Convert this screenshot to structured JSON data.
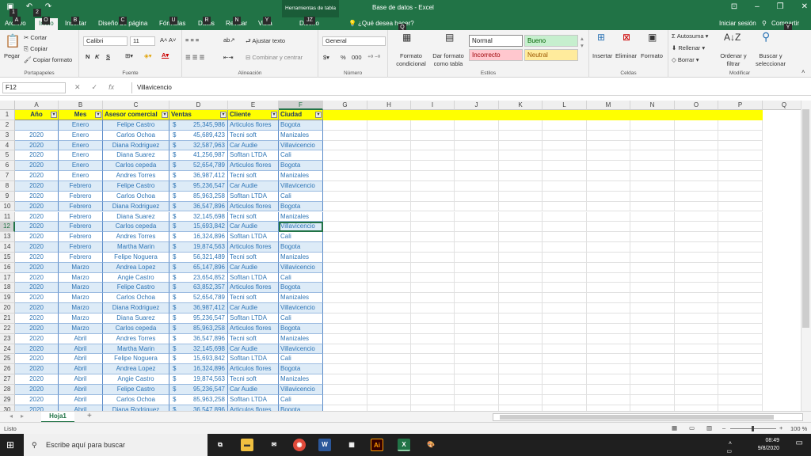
{
  "window": {
    "doc_title": "Base de datos - Excel",
    "context_title": "Herramientas de tabla",
    "icons": [
      "save-icon",
      "undo-icon",
      "redo-icon",
      "ribbon-display-icon",
      "minimize-icon",
      "restore-icon",
      "close-icon"
    ]
  },
  "keytips": [
    "1",
    "2",
    "A",
    "O",
    "B",
    "C",
    "U",
    "R",
    "N",
    "Y",
    "JZ",
    "Q"
  ],
  "tabs": {
    "archivo": "Archivo",
    "inicio": "Inicio",
    "insertar": "Insertar",
    "diseno_pagina": "Diseño de página",
    "formulas": "Fórmulas",
    "datos": "Datos",
    "revisar": "Revisar",
    "vista": "Vista",
    "diseno": "Diseño",
    "search": "¿Qué desea hacer?",
    "signin": "Iniciar sesión",
    "share": "Compartir"
  },
  "ribbon": {
    "clipboard": {
      "paste": "Pegar",
      "cut": "Cortar",
      "copy": "Copiar",
      "format_painter": "Copiar formato",
      "label": "Portapapeles"
    },
    "font": {
      "name": "Calibri",
      "size": "11",
      "bold": "N",
      "italic": "K",
      "underline": "S",
      "label": "Fuente"
    },
    "alignment": {
      "wrap": "Ajustar texto",
      "merge": "Combinar y centrar",
      "label": "Alineación"
    },
    "number": {
      "format": "General",
      "percent": "%",
      "thousands": "000",
      "label": "Número"
    },
    "styles": {
      "conditional": "Formato condicional",
      "as_table": "Dar formato como tabla",
      "normal": "Normal",
      "bueno": "Bueno",
      "incorrecto": "Incorrecto",
      "neutral": "Neutral",
      "label": "Estilos"
    },
    "cells": {
      "insert": "Insertar",
      "delete": "Eliminar",
      "format": "Formato",
      "label": "Celdas"
    },
    "editing": {
      "autosum": "Autosuma",
      "fill": "Rellenar",
      "clear": "Borrar",
      "sort": "Ordenar y filtrar",
      "find": "Buscar y seleccionar",
      "label": "Modificar"
    },
    "colors": {
      "green": "#217346",
      "bueno_bg": "#c6efce",
      "bueno_fg": "#006100",
      "incorrecto_bg": "#ffc7ce",
      "incorrecto_fg": "#9c0006",
      "neutral_bg": "#ffeb9c",
      "neutral_fg": "#9c5700"
    }
  },
  "formula_bar": {
    "name_box": "F12",
    "content": "Villavicencio"
  },
  "grid": {
    "columns": [
      "A",
      "B",
      "C",
      "D",
      "E",
      "F",
      "G",
      "H",
      "I",
      "J",
      "K",
      "L",
      "M",
      "N",
      "O",
      "P",
      "Q"
    ],
    "selected_col": "F",
    "selected_row": "12",
    "headers": [
      "Año",
      "Mes",
      "Asesor comercial",
      "Ventas",
      "Cliente",
      "Ciudad"
    ],
    "rows": [
      [
        "1",
        "",
        "",
        "",
        "",
        "",
        ""
      ],
      [
        "2",
        "",
        "Enero",
        "Felipe Castro",
        "25,345,986",
        "Articulos flores",
        "Bogota"
      ],
      [
        "3",
        "2020",
        "Enero",
        "Carlos Ochoa",
        "45,689,423",
        "Tecni soft",
        "Manizales"
      ],
      [
        "4",
        "2020",
        "Enero",
        "Diana Rodriguez",
        "32,587,963",
        "Car Audie",
        "Villavicencio"
      ],
      [
        "5",
        "2020",
        "Enero",
        "Diana Suarez",
        "41,256,987",
        "Sofltan LTDA",
        "Cali"
      ],
      [
        "6",
        "2020",
        "Enero",
        "Carlos cepeda",
        "52,654,789",
        "Articulos flores",
        "Bogota"
      ],
      [
        "7",
        "2020",
        "Enero",
        "Andres Torres",
        "36,987,412",
        "Tecni soft",
        "Manizales"
      ],
      [
        "8",
        "2020",
        "Febrero",
        "Felipe Castro",
        "95,236,547",
        "Car Audie",
        "Villavicencio"
      ],
      [
        "9",
        "2020",
        "Febrero",
        "Carlos Ochoa",
        "85,963,258",
        "Sofltan LTDA",
        "Cali"
      ],
      [
        "10",
        "2020",
        "Febrero",
        "Diana Rodriguez",
        "36,547,896",
        "Articulos flores",
        "Bogota"
      ],
      [
        "11",
        "2020",
        "Febrero",
        "Diana Suarez",
        "32,145,698",
        "Tecni soft",
        "Manizales"
      ],
      [
        "12",
        "2020",
        "Febrero",
        "Carlos cepeda",
        "15,693,842",
        "Car Audie",
        "Villavicencio"
      ],
      [
        "13",
        "2020",
        "Febrero",
        "Andres Torres",
        "16,324,896",
        "Sofltan LTDA",
        "Cali"
      ],
      [
        "14",
        "2020",
        "Febrero",
        "Martha Marin",
        "19,874,563",
        "Articulos flores",
        "Bogota"
      ],
      [
        "15",
        "2020",
        "Febrero",
        "Felipe Noguera",
        "56,321,489",
        "Tecni soft",
        "Manizales"
      ],
      [
        "16",
        "2020",
        "Marzo",
        "Andrea Lopez",
        "65,147,896",
        "Car Audie",
        "Villavicencio"
      ],
      [
        "17",
        "2020",
        "Marzo",
        "Angie Castro",
        "23,654,852",
        "Sofltan LTDA",
        "Cali"
      ],
      [
        "18",
        "2020",
        "Marzo",
        "Felipe Castro",
        "63,852,357",
        "Articulos flores",
        "Bogota"
      ],
      [
        "19",
        "2020",
        "Marzo",
        "Carlos Ochoa",
        "52,654,789",
        "Tecni soft",
        "Manizales"
      ],
      [
        "20",
        "2020",
        "Marzo",
        "Diana Rodriguez",
        "36,987,412",
        "Car Audie",
        "Villavicencio"
      ],
      [
        "21",
        "2020",
        "Marzo",
        "Diana Suarez",
        "95,236,547",
        "Sofltan LTDA",
        "Cali"
      ],
      [
        "22",
        "2020",
        "Marzo",
        "Carlos cepeda",
        "85,963,258",
        "Articulos flores",
        "Bogota"
      ],
      [
        "23",
        "2020",
        "Abril",
        "Andres Torres",
        "36,547,896",
        "Tecni soft",
        "Manizales"
      ],
      [
        "24",
        "2020",
        "Abril",
        "Martha Marin",
        "32,145,698",
        "Car Audie",
        "Villavicencio"
      ],
      [
        "25",
        "2020",
        "Abril",
        "Felipe Noguera",
        "15,693,842",
        "Sofltan LTDA",
        "Cali"
      ],
      [
        "26",
        "2020",
        "Abril",
        "Andrea Lopez",
        "16,324,896",
        "Articulos flores",
        "Bogota"
      ],
      [
        "27",
        "2020",
        "Abril",
        "Angie Castro",
        "19,874,563",
        "Tecni soft",
        "Manizales"
      ],
      [
        "28",
        "2020",
        "Abril",
        "Felipe Castro",
        "95,236,547",
        "Car Audie",
        "Villavicencio"
      ],
      [
        "29",
        "2020",
        "Abril",
        "Carlos Ochoa",
        "85,963,258",
        "Sofltan LTDA",
        "Cali"
      ],
      [
        "30",
        "2020",
        "Abril",
        "Diana Rodriguez",
        "36,547,896",
        "Articulos flores",
        "Bogota"
      ]
    ],
    "currency": "$",
    "colors": {
      "header_fill": "#ffff00",
      "band_fill": "#ddebf7",
      "text_blue": "#2e75b6"
    }
  },
  "sheets": {
    "active": "Hoja1",
    "add": "+"
  },
  "status": {
    "ready": "Listo",
    "zoom": "100 %"
  },
  "taskbar": {
    "search": "Escribe aquí para buscar",
    "time": "08:49",
    "date": "9/8/2020"
  }
}
